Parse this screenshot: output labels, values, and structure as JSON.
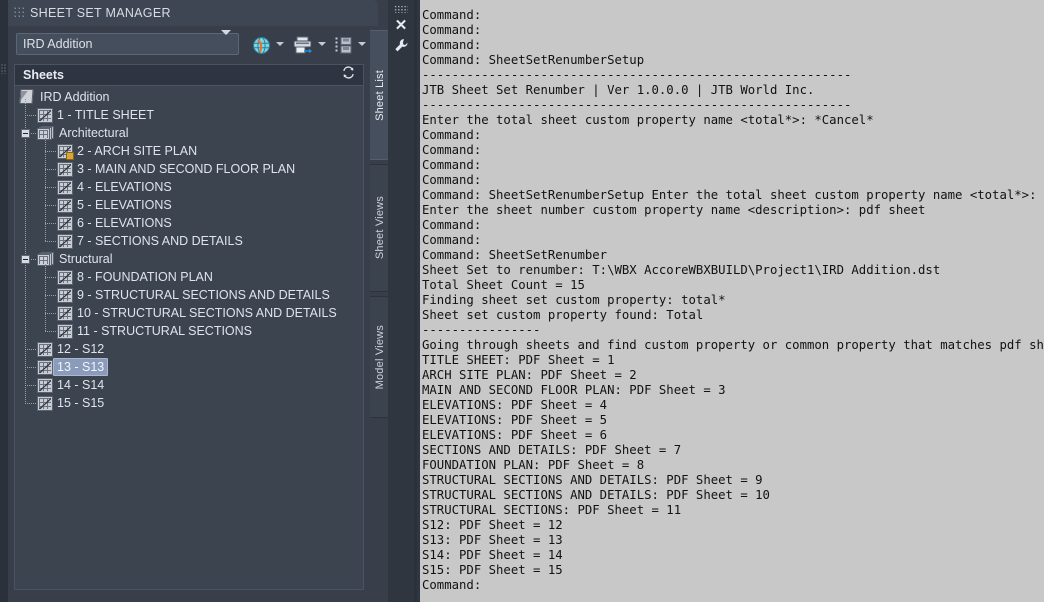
{
  "palette": {
    "title": "SHEET SET MANAGER",
    "grip_icon": "drag-grip-dots",
    "close_icon": "close-icon",
    "wrench_icon": "wrench-icon",
    "sheetset_combo": {
      "value": "IRD Addition",
      "arrow_icon": "chevron-down-icon"
    },
    "toolbar_buttons": [
      {
        "name": "publish",
        "icon": "globe-publish-icon",
        "arrow_icon": "chevron-down-icon"
      },
      {
        "name": "plot",
        "icon": "printer-icon",
        "arrow_icon": "chevron-down-icon"
      },
      {
        "name": "etransmit",
        "icon": "sheet-save-icon",
        "arrow_icon": "chevron-down-icon"
      }
    ],
    "tabs": [
      {
        "label": "Sheet List",
        "active": true
      },
      {
        "label": "Sheet Views",
        "active": false
      },
      {
        "label": "Model Views",
        "active": false
      }
    ],
    "sheets_header": {
      "label": "Sheets",
      "refresh_icon": "refresh-icon"
    },
    "tree": [
      {
        "level": 0,
        "type": "sheetset",
        "label": "IRD Addition",
        "icon": "sheetset-icon",
        "expanded": true,
        "selected": false
      },
      {
        "level": 1,
        "type": "sheet",
        "label": "1 - TITLE SHEET",
        "icon": "sheet-icon",
        "selected": false
      },
      {
        "level": 1,
        "type": "subset",
        "label": "Architectural",
        "icon": "subset-icon",
        "expanded": true,
        "selected": false
      },
      {
        "level": 2,
        "type": "sheet",
        "label": "2 - ARCH SITE PLAN",
        "icon": "sheet-locked-icon",
        "locked": true,
        "selected": false
      },
      {
        "level": 2,
        "type": "sheet",
        "label": "3 - MAIN AND SECOND FLOOR PLAN",
        "icon": "sheet-icon",
        "selected": false
      },
      {
        "level": 2,
        "type": "sheet",
        "label": "4 - ELEVATIONS",
        "icon": "sheet-icon",
        "selected": false
      },
      {
        "level": 2,
        "type": "sheet",
        "label": "5 - ELEVATIONS",
        "icon": "sheet-icon",
        "selected": false
      },
      {
        "level": 2,
        "type": "sheet",
        "label": "6 - ELEVATIONS",
        "icon": "sheet-icon",
        "selected": false
      },
      {
        "level": 2,
        "type": "sheet",
        "label": "7 - SECTIONS AND DETAILS",
        "icon": "sheet-icon",
        "selected": false
      },
      {
        "level": 1,
        "type": "subset",
        "label": "Structural",
        "icon": "subset-icon",
        "expanded": true,
        "selected": false
      },
      {
        "level": 2,
        "type": "sheet",
        "label": "8 - FOUNDATION PLAN",
        "icon": "sheet-icon",
        "selected": false
      },
      {
        "level": 2,
        "type": "sheet",
        "label": "9 - STRUCTURAL SECTIONS AND DETAILS",
        "icon": "sheet-icon",
        "selected": false
      },
      {
        "level": 2,
        "type": "sheet",
        "label": "10 - STRUCTURAL SECTIONS AND DETAILS",
        "icon": "sheet-icon",
        "selected": false
      },
      {
        "level": 2,
        "type": "sheet",
        "label": "11 - STRUCTURAL SECTIONS",
        "icon": "sheet-icon",
        "selected": false
      },
      {
        "level": 1,
        "type": "sheet",
        "label": "12 - S12",
        "icon": "sheet-icon",
        "selected": false
      },
      {
        "level": 1,
        "type": "sheet",
        "label": "13 - S13",
        "icon": "sheet-icon",
        "selected": true
      },
      {
        "level": 1,
        "type": "sheet",
        "label": "14 - S14",
        "icon": "sheet-icon",
        "selected": false
      },
      {
        "level": 1,
        "type": "sheet",
        "label": "15 - S15",
        "icon": "sheet-icon",
        "selected": false
      }
    ]
  },
  "command_window": {
    "lines": [
      "Command:",
      "Command:",
      "Command:",
      "Command: SheetSetRenumberSetup",
      "----------------------------------------------------------",
      "JTB Sheet Set Renumber | Ver 1.0.0.0 | JTB World Inc.",
      "----------------------------------------------------------",
      "Enter the total sheet custom property name <total*>: *Cancel*",
      "Command:",
      "Command:",
      "Command:",
      "Command:",
      "Command: SheetSetRenumberSetup Enter the total sheet custom property name <total*>:",
      "Enter the sheet number custom property name <description>: pdf sheet",
      "Command:",
      "Command:",
      "Command: SheetSetRenumber",
      "Sheet Set to renumber: T:\\WBX AccoreWBXBUILD\\Project1\\IRD Addition.dst",
      "Total Sheet Count = 15",
      "Finding sheet set custom property: total*",
      "Sheet set custom property found: Total",
      "----------------",
      "Going through sheets and find custom property or common property that matches pdf sheet",
      "TITLE SHEET: PDF Sheet = 1",
      "ARCH SITE PLAN: PDF Sheet = 2",
      "MAIN AND SECOND FLOOR PLAN: PDF Sheet = 3",
      "ELEVATIONS: PDF Sheet = 4",
      "ELEVATIONS: PDF Sheet = 5",
      "ELEVATIONS: PDF Sheet = 6",
      "SECTIONS AND DETAILS: PDF Sheet = 7",
      "FOUNDATION PLAN: PDF Sheet = 8",
      "STRUCTURAL SECTIONS AND DETAILS: PDF Sheet = 9",
      "STRUCTURAL SECTIONS AND DETAILS: PDF Sheet = 10",
      "STRUCTURAL SECTIONS: PDF Sheet = 11",
      "S12: PDF Sheet = 12",
      "S13: PDF Sheet = 13",
      "S14: PDF Sheet = 14",
      "S15: PDF Sheet = 15",
      "Command:"
    ]
  },
  "colors": {
    "palette_bg": "#383f4b",
    "titlebar_bg": "#3e4654",
    "tree_bg": "#3c4450",
    "selection": "#8a9bbb",
    "command_bg": "#c8c8c8",
    "text": "#dfe4ec"
  }
}
